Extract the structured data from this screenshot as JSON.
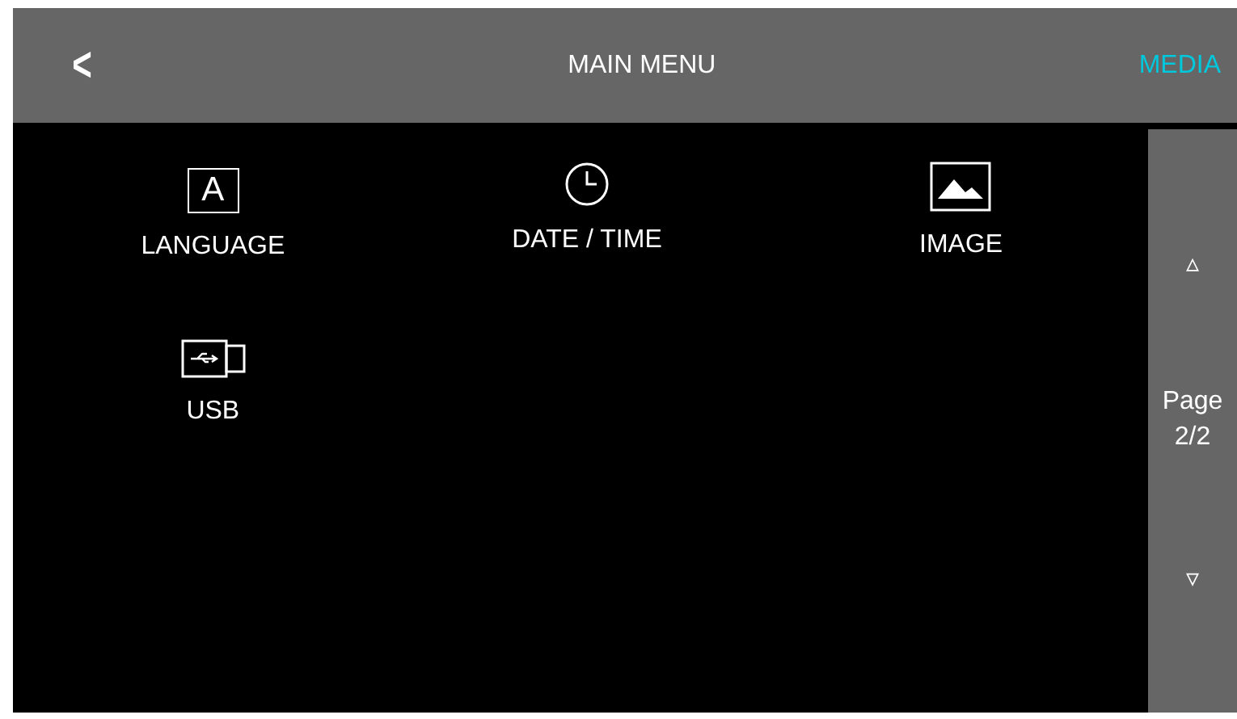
{
  "header": {
    "back": "<",
    "title": "MAIN MENU",
    "action": "MEDIA"
  },
  "menu_items": [
    {
      "kind": "language",
      "icon_text": "A",
      "label": "LANGUAGE"
    },
    {
      "kind": "clock",
      "label": "DATE / TIME"
    },
    {
      "kind": "image",
      "label": "IMAGE"
    },
    {
      "kind": "usb",
      "label": "USB"
    }
  ],
  "pager": {
    "up": "▵",
    "label": "Page",
    "page": "2/2",
    "down": "▿"
  }
}
